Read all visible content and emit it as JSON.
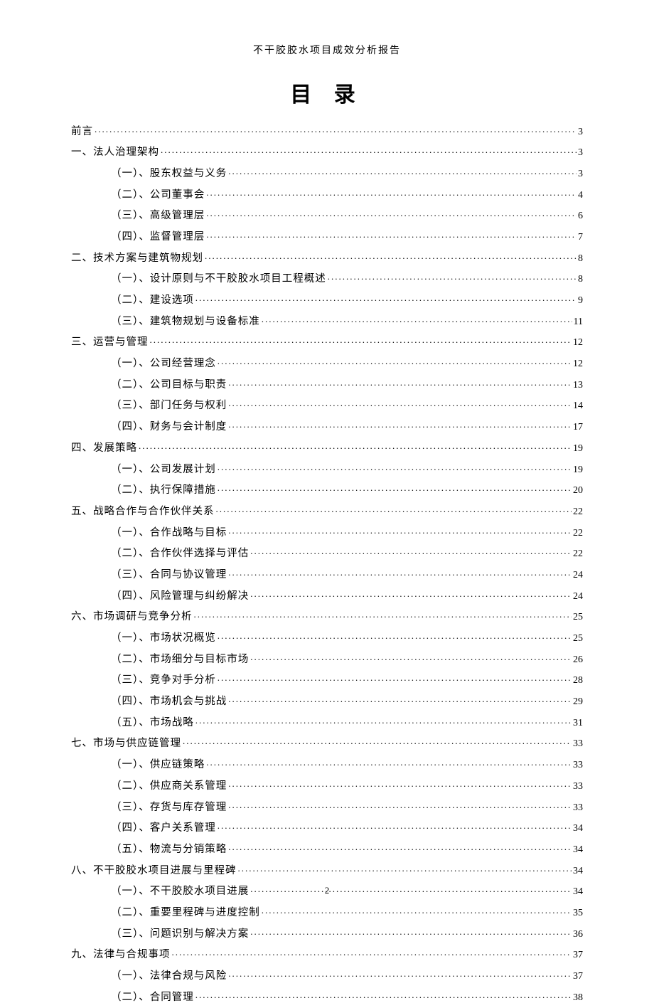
{
  "header": "不干胶胶水项目成效分析报告",
  "title": "目 录",
  "page_number": "2",
  "toc": [
    {
      "level": 1,
      "label": "前言",
      "page": "3"
    },
    {
      "level": 1,
      "label": "一、法人治理架构",
      "page": "3"
    },
    {
      "level": 2,
      "label": "（一）、股东权益与义务",
      "page": "3"
    },
    {
      "level": 2,
      "label": "（二）、公司董事会",
      "page": "4"
    },
    {
      "level": 2,
      "label": "（三）、高级管理层",
      "page": "6"
    },
    {
      "level": 2,
      "label": "（四）、监督管理层",
      "page": "7"
    },
    {
      "level": 1,
      "label": "二、技术方案与建筑物规划",
      "page": "8"
    },
    {
      "level": 2,
      "label": "（一）、设计原则与不干胶胶水项目工程概述",
      "page": "8"
    },
    {
      "level": 2,
      "label": "（二）、建设选项",
      "page": "9"
    },
    {
      "level": 2,
      "label": "（三）、建筑物规划与设备标准",
      "page": "11"
    },
    {
      "level": 1,
      "label": "三、运营与管理",
      "page": "12"
    },
    {
      "level": 2,
      "label": "（一）、公司经营理念",
      "page": "12"
    },
    {
      "level": 2,
      "label": "（二）、公司目标与职责",
      "page": "13"
    },
    {
      "level": 2,
      "label": "（三）、部门任务与权利",
      "page": "14"
    },
    {
      "level": 2,
      "label": "（四）、财务与会计制度",
      "page": "17"
    },
    {
      "level": 1,
      "label": "四、发展策略",
      "page": "19"
    },
    {
      "level": 2,
      "label": "（一）、公司发展计划",
      "page": "19"
    },
    {
      "level": 2,
      "label": "（二）、执行保障措施",
      "page": "20"
    },
    {
      "level": 1,
      "label": "五、战略合作与合作伙伴关系",
      "page": "22"
    },
    {
      "level": 2,
      "label": "（一）、合作战略与目标",
      "page": "22"
    },
    {
      "level": 2,
      "label": "（二）、合作伙伴选择与评估",
      "page": "22"
    },
    {
      "level": 2,
      "label": "（三）、合同与协议管理",
      "page": "24"
    },
    {
      "level": 2,
      "label": "（四）、风险管理与纠纷解决",
      "page": "24"
    },
    {
      "level": 1,
      "label": "六、市场调研与竞争分析",
      "page": "25"
    },
    {
      "level": 2,
      "label": "（一）、市场状况概览",
      "page": "25"
    },
    {
      "level": 2,
      "label": "（二）、市场细分与目标市场",
      "page": "26"
    },
    {
      "level": 2,
      "label": "（三）、竞争对手分析",
      "page": "28"
    },
    {
      "level": 2,
      "label": "（四）、市场机会与挑战",
      "page": "29"
    },
    {
      "level": 2,
      "label": "（五）、市场战略",
      "page": "31"
    },
    {
      "level": 1,
      "label": "七、市场与供应链管理",
      "page": "33"
    },
    {
      "level": 2,
      "label": "（一）、供应链策略",
      "page": "33"
    },
    {
      "level": 2,
      "label": "（二）、供应商关系管理",
      "page": "33"
    },
    {
      "level": 2,
      "label": "（三）、存货与库存管理",
      "page": "33"
    },
    {
      "level": 2,
      "label": "（四）、客户关系管理",
      "page": "34"
    },
    {
      "level": 2,
      "label": "（五）、物流与分销策略",
      "page": "34"
    },
    {
      "level": 1,
      "label": "八、不干胶胶水项目进展与里程碑",
      "page": "34"
    },
    {
      "level": 2,
      "label": "（一）、不干胶胶水项目进展",
      "page": "34"
    },
    {
      "level": 2,
      "label": "（二）、重要里程碑与进度控制",
      "page": "35"
    },
    {
      "level": 2,
      "label": "（三）、问题识别与解决方案",
      "page": "36"
    },
    {
      "level": 1,
      "label": "九、法律与合规事项",
      "page": "37"
    },
    {
      "level": 2,
      "label": "（一）、法律合规与风险",
      "page": "37"
    },
    {
      "level": 2,
      "label": "（二）、合同管理",
      "page": "38"
    }
  ]
}
